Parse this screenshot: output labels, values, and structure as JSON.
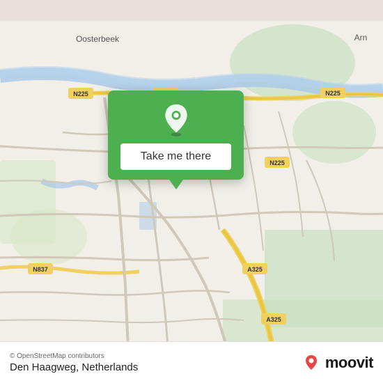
{
  "map": {
    "background_color": "#f2efe9",
    "center_lat": 51.97,
    "center_lon": 5.88
  },
  "popup": {
    "button_label": "Take me there",
    "background_color": "#4caf50"
  },
  "bottom_bar": {
    "osm_credit": "© OpenStreetMap contributors",
    "location_name": "Den Haagweg, Netherlands",
    "logo_text": "moovit"
  }
}
